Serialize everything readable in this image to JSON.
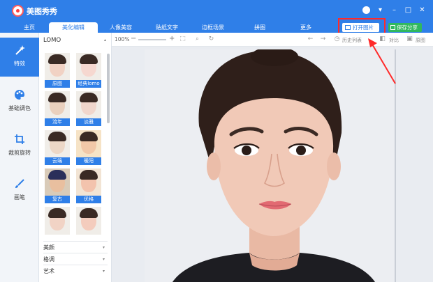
{
  "app": {
    "title": "美图秀秀"
  },
  "nav": {
    "tabs": [
      "主页",
      "美化编辑",
      "人像美容",
      "贴纸文字",
      "边框场景",
      "拼图",
      "更多"
    ],
    "open_button": "打开图片",
    "save_button": "保存分享"
  },
  "sidebar": {
    "items": [
      {
        "label": "特效",
        "icon": "magic-wand-icon"
      },
      {
        "label": "基础调色",
        "icon": "palette-icon"
      },
      {
        "label": "裁剪旋转",
        "icon": "crop-icon"
      },
      {
        "label": "画笔",
        "icon": "brush-icon"
      }
    ]
  },
  "effects": {
    "category": "LOMO",
    "thumbnails": [
      "原图",
      "经典lomo",
      "流年",
      "淡雅",
      "云端",
      "暖阳",
      "复古",
      "优格"
    ],
    "sections": [
      "美颜",
      "格调",
      "艺术"
    ]
  },
  "toolbar": {
    "zoom": "100%",
    "history": "历史列表",
    "compare": "对比",
    "original": "原图"
  },
  "colors": {
    "accent": "#2f7fe8",
    "save_green": "#30b85e",
    "highlight": "#ff2a2a"
  }
}
